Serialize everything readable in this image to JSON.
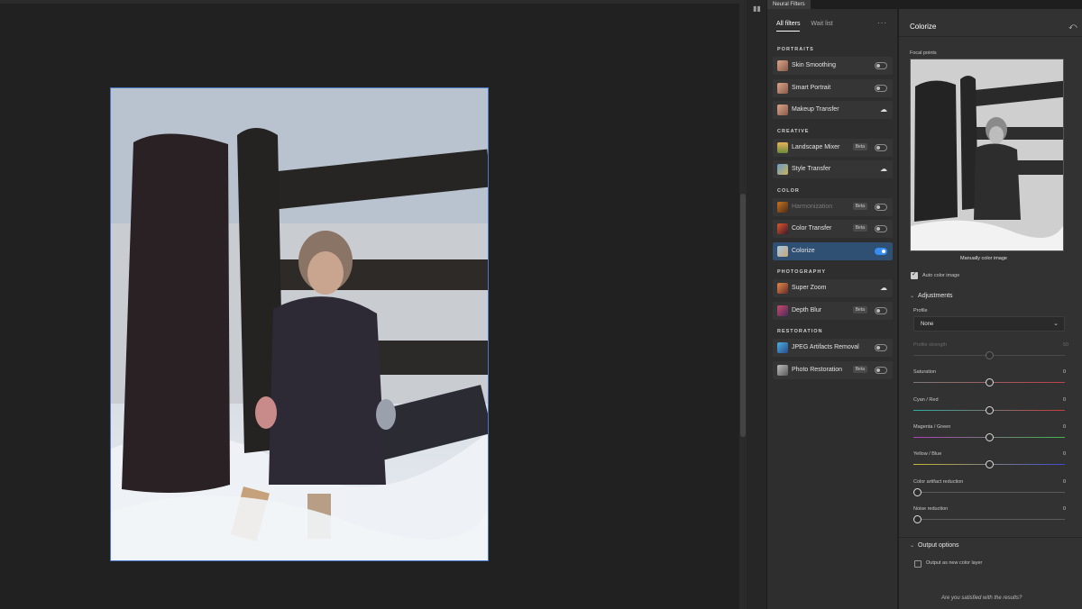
{
  "panel": {
    "tab_title": "Neural Filters"
  },
  "list": {
    "tabs": [
      "All filters",
      "Wait list"
    ],
    "more_label": "···",
    "categories": [
      {
        "name": "PORTRAITS",
        "items": [
          {
            "label": "Skin Smoothing",
            "control": "toggle",
            "on": false,
            "beta": false,
            "icon": "face-thumb"
          },
          {
            "label": "Smart Portrait",
            "control": "toggle",
            "on": false,
            "beta": false,
            "icon": "face-thumb"
          },
          {
            "label": "Makeup Transfer",
            "control": "cloud",
            "beta": false,
            "icon": "face-thumb"
          }
        ]
      },
      {
        "name": "CREATIVE",
        "items": [
          {
            "label": "Landscape Mixer",
            "control": "toggle",
            "on": false,
            "beta": true,
            "icon": "landscape-thumb"
          },
          {
            "label": "Style Transfer",
            "control": "cloud",
            "beta": false,
            "icon": "painting-thumb"
          }
        ]
      },
      {
        "name": "COLOR",
        "items": [
          {
            "label": "Harmonization",
            "control": "toggle",
            "on": false,
            "beta": true,
            "disabled": true,
            "icon": "harmonize-thumb"
          },
          {
            "label": "Color Transfer",
            "control": "toggle",
            "on": false,
            "beta": true,
            "icon": "color-transfer-thumb"
          },
          {
            "label": "Colorize",
            "control": "toggle",
            "on": true,
            "beta": false,
            "selected": true,
            "icon": "colorize-thumb"
          }
        ]
      },
      {
        "name": "PHOTOGRAPHY",
        "items": [
          {
            "label": "Super Zoom",
            "control": "cloud",
            "beta": false,
            "icon": "zoom-thumb"
          },
          {
            "label": "Depth Blur",
            "control": "toggle",
            "on": false,
            "beta": true,
            "icon": "blur-thumb"
          }
        ]
      },
      {
        "name": "RESTORATION",
        "items": [
          {
            "label": "JPEG Artifacts Removal",
            "control": "toggle",
            "on": false,
            "beta": false,
            "icon": "jpeg-thumb"
          },
          {
            "label": "Photo Restoration",
            "control": "toggle",
            "on": false,
            "beta": true,
            "icon": "restore-thumb"
          }
        ]
      }
    ],
    "beta_label": "Beta"
  },
  "settings": {
    "title": "Colorize",
    "focal_label": "Focal points",
    "manual_label": "Manually color image",
    "auto_color_label": "Auto color image",
    "auto_color_checked": true,
    "adjustments_label": "Adjustments",
    "profile_label": "Profile",
    "profile_value": "None",
    "sliders": [
      {
        "label": "Profile strength",
        "value": "50",
        "fraction": 0.5,
        "disabled": true,
        "track": "#4a4a4a"
      },
      {
        "label": "Saturation",
        "value": "0",
        "fraction": 0.5,
        "track": "linear-gradient(90deg,#7a7a7a,#c0404a)"
      },
      {
        "label": "Cyan / Red",
        "value": "0",
        "fraction": 0.5,
        "track": "linear-gradient(90deg,#2bb0a8,#c83c3c)"
      },
      {
        "label": "Magenta / Green",
        "value": "0",
        "fraction": 0.5,
        "track": "linear-gradient(90deg,#b23cb8,#3cb84a)"
      },
      {
        "label": "Yellow / Blue",
        "value": "0",
        "fraction": 0.5,
        "track": "linear-gradient(90deg,#c8b830,#3a4cd0)"
      },
      {
        "label": "Color artifact reduction",
        "value": "0",
        "fraction": 0.0,
        "track": "#5a5a5a"
      },
      {
        "label": "Noise reduction",
        "value": "0",
        "fraction": 0.0,
        "track": "#5a5a5a"
      }
    ],
    "output_label": "Output options",
    "output_layer_label": "Output as new color layer",
    "output_layer_checked": false,
    "footer": "Are you satisfied with the results?"
  }
}
